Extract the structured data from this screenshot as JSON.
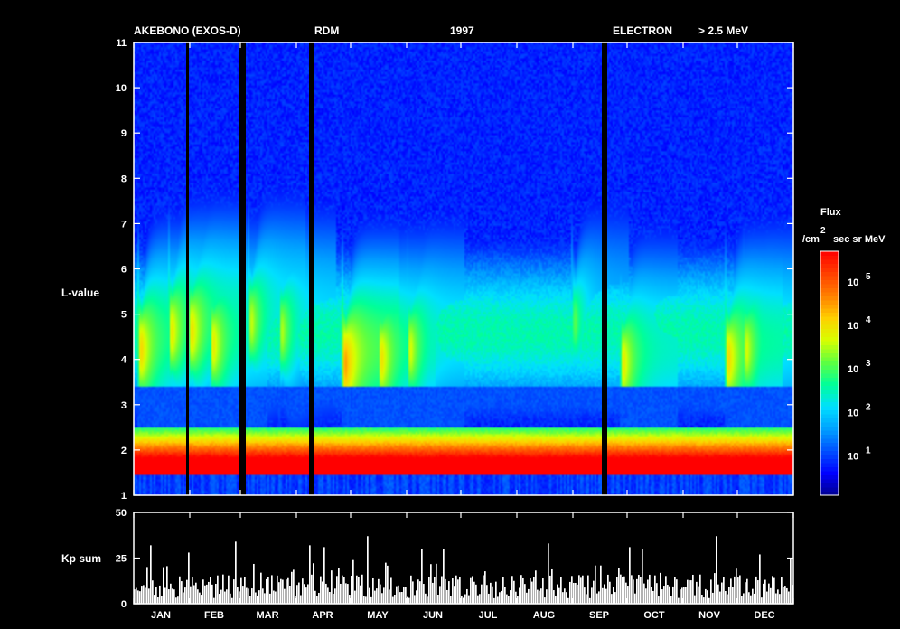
{
  "header": {
    "mission": "AKEBONO (EXOS-D)",
    "instrument": "RDM",
    "year": "1997",
    "particle": "ELECTRON",
    "energy": "> 2.5 MeV"
  },
  "colorbar": {
    "title": "Flux",
    "unit_prefix": "/cm",
    "unit_superscript": "2",
    "unit_suffix": "sec sr MeV",
    "tick_labels": [
      {
        "base": "10",
        "exp": "1",
        "log": 1
      },
      {
        "base": "10",
        "exp": "2",
        "log": 2
      },
      {
        "base": "10",
        "exp": "3",
        "log": 3
      },
      {
        "base": "10",
        "exp": "4",
        "log": 4
      },
      {
        "base": "10",
        "exp": "5",
        "log": 5
      }
    ],
    "range_log": [
      0.1,
      5.7
    ],
    "colors": [
      "#00008f",
      "#0000ff",
      "#0050ff",
      "#00a0ff",
      "#00e0ff",
      "#00ff9a",
      "#60ff40",
      "#d8ff00",
      "#ffd000",
      "#ff8000",
      "#ff4000",
      "#ff0000"
    ]
  },
  "chart_data": [
    {
      "type": "heatmap",
      "title": "",
      "xlabel": "",
      "ylabel": "L-value",
      "xlim": [
        1,
        366
      ],
      "ylim": [
        1,
        11
      ],
      "y_ticks": [
        1,
        2,
        3,
        4,
        5,
        6,
        7,
        8,
        9,
        10,
        11
      ],
      "z_unit": "log10 Flux (/cm2 sec sr MeV)",
      "data_gaps_doy": [
        [
          59,
          63
        ],
        [
          98,
          101
        ],
        [
          260,
          263
        ]
      ],
      "thin_gaps_doy": [
        30
      ],
      "slot_region_L": [
        2.5,
        3.4
      ],
      "inner_belt_edge_L": 2.2,
      "outer_belt_peaks": [
        {
          "doy": 5,
          "L": 4.2,
          "log_flux": 4.2
        },
        {
          "doy": 22,
          "L": 4.6,
          "log_flux": 4.0
        },
        {
          "doy": 33,
          "L": 4.6,
          "log_flux": 4.1
        },
        {
          "doy": 45,
          "L": 4.3,
          "log_flux": 4.0
        },
        {
          "doy": 66,
          "L": 4.8,
          "log_flux": 3.7
        },
        {
          "doy": 83,
          "L": 4.6,
          "log_flux": 3.6
        },
        {
          "doy": 118,
          "L": 3.9,
          "log_flux": 4.6
        },
        {
          "doy": 138,
          "L": 4.0,
          "log_flux": 4.1
        },
        {
          "doy": 154,
          "L": 4.2,
          "log_flux": 3.8
        },
        {
          "doy": 245,
          "L": 4.8,
          "log_flux": 3.2
        },
        {
          "doy": 272,
          "L": 3.9,
          "log_flux": 4.0
        },
        {
          "doy": 330,
          "L": 4.0,
          "log_flux": 4.2
        },
        {
          "doy": 340,
          "L": 4.2,
          "log_flux": 3.8
        }
      ]
    },
    {
      "type": "bar",
      "title": "",
      "xlabel": "",
      "ylabel": "Kp sum",
      "ylim": [
        0,
        50
      ],
      "y_ticks": [
        0,
        25,
        50
      ],
      "x_tick_labels": [
        "JAN",
        "FEB",
        "MAR",
        "APR",
        "MAY",
        "JUN",
        "JUL",
        "AUG",
        "SEP",
        "OCT",
        "NOV",
        "DEC"
      ],
      "x_tick_centers_doy": [
        16,
        45.5,
        75,
        105.5,
        136,
        166.5,
        197,
        228,
        258.5,
        289,
        319.5,
        350
      ],
      "month_starts_doy": [
        1,
        32,
        60,
        91,
        121,
        152,
        182,
        213,
        244,
        274,
        305,
        335,
        366
      ],
      "spikes": [
        {
          "doy": 10,
          "value": 32
        },
        {
          "doy": 31,
          "value": 28
        },
        {
          "doy": 57,
          "value": 34
        },
        {
          "doy": 98,
          "value": 32
        },
        {
          "doy": 106,
          "value": 31
        },
        {
          "doy": 130,
          "value": 37
        },
        {
          "doy": 160,
          "value": 30
        },
        {
          "doy": 172,
          "value": 30
        },
        {
          "doy": 230,
          "value": 33
        },
        {
          "doy": 275,
          "value": 31
        },
        {
          "doy": 282,
          "value": 30
        },
        {
          "doy": 323,
          "value": 37
        },
        {
          "doy": 347,
          "value": 27
        },
        {
          "doy": 364,
          "value": 25
        }
      ],
      "baseline_range": [
        3,
        16
      ]
    }
  ]
}
